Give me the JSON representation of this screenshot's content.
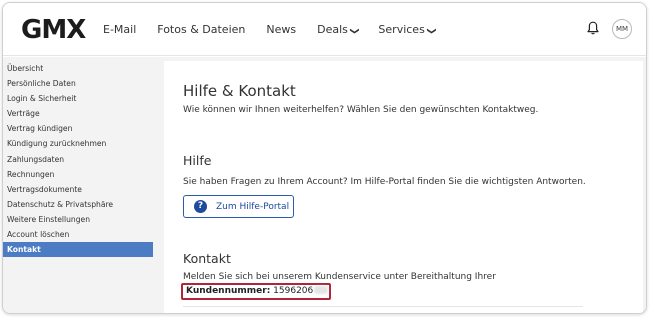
{
  "header": {
    "logo": "GMX",
    "nav": [
      {
        "label": "E-Mail",
        "has_chevron": false
      },
      {
        "label": "Fotos & Dateien",
        "has_chevron": false
      },
      {
        "label": "News",
        "has_chevron": false
      },
      {
        "label": "Deals",
        "has_chevron": true
      },
      {
        "label": "Services",
        "has_chevron": true
      }
    ],
    "chevron": "❯",
    "avatar_initials": "MM"
  },
  "sidebar": {
    "items": [
      {
        "label": "Übersicht"
      },
      {
        "label": "Persönliche Daten"
      },
      {
        "label": "Login & Sicherheit"
      },
      {
        "label": "Verträge"
      },
      {
        "label": "Vertrag kündigen"
      },
      {
        "label": "Kündigung zurücknehmen"
      },
      {
        "label": "Zahlungsdaten"
      },
      {
        "label": "Rechnungen"
      },
      {
        "label": "Vertragsdokumente"
      },
      {
        "label": "Datenschutz & Privatsphäre"
      },
      {
        "label": "Weitere Einstellungen"
      },
      {
        "label": "Account löschen"
      },
      {
        "label": "Kontakt"
      }
    ],
    "active_index": 12
  },
  "main": {
    "title": "Hilfe & Kontakt",
    "intro": "Wie können wir Ihnen weiterhelfen? Wählen Sie den gewünschten Kontaktweg.",
    "help": {
      "heading": "Hilfe",
      "text": "Sie haben Fragen zu Ihrem Account? Im Hilfe-Portal finden Sie die wichtigsten Antworten.",
      "button_icon": "?",
      "button_label": "Zum Hilfe-Portal"
    },
    "contact": {
      "heading": "Kontakt",
      "text": "Melden Sie sich bei unserem Kundenservice unter Bereithaltung Ihrer",
      "customer_number_label": "Kundennummer:",
      "customer_number_value": "1596206"
    }
  },
  "colors": {
    "accent": "#4b7cc4",
    "button_border": "#2a5bb0",
    "highlight_box": "#b0243c",
    "sidebar_bg": "#f3f3f3"
  }
}
